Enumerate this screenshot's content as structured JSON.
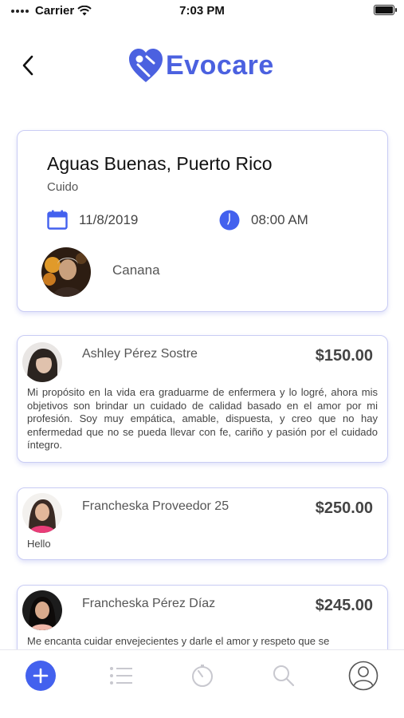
{
  "status_bar": {
    "carrier": "Carrier",
    "time": "7:03 PM"
  },
  "header": {
    "logo_text": "Evocare",
    "back_icon": "chevron-left-icon"
  },
  "summary": {
    "location": "Aguas Buenas, Puerto Rico",
    "service": "Cuido",
    "date": "11/8/2019",
    "time": "08:00 AM",
    "patient_name": "Canana",
    "date_icon": "calendar-icon",
    "time_icon": "clock-icon"
  },
  "offers": [
    {
      "name": "Ashley Pérez Sostre",
      "price": "$150.00",
      "text": "Mi propósito en la vida era graduarme de enfermera y lo logré, ahora mis objetivos son brindar un cuidado de calidad basado en el amor por mi profesión. Soy muy empática, amable, dispuesta, y creo que no hay enfermedad que no se pueda llevar con fe, cariño y pasión por el cuidado íntegro."
    },
    {
      "name": "Francheska Proveedor 25",
      "price": "$250.00",
      "text": "Hello"
    },
    {
      "name": "Francheska Pérez Díaz",
      "price": "$245.00",
      "text": "Me encanta cuidar envejecientes y darle el amor y respeto que se"
    }
  ],
  "tab_bar": {
    "items": [
      "add-icon",
      "list-icon",
      "timer-icon",
      "search-icon",
      "profile-icon"
    ]
  },
  "colors": {
    "accent": "#4361ee",
    "logo": "#4b61e0",
    "card_border": "#c9ccf4",
    "inactive_icon": "#c8c8cf"
  }
}
